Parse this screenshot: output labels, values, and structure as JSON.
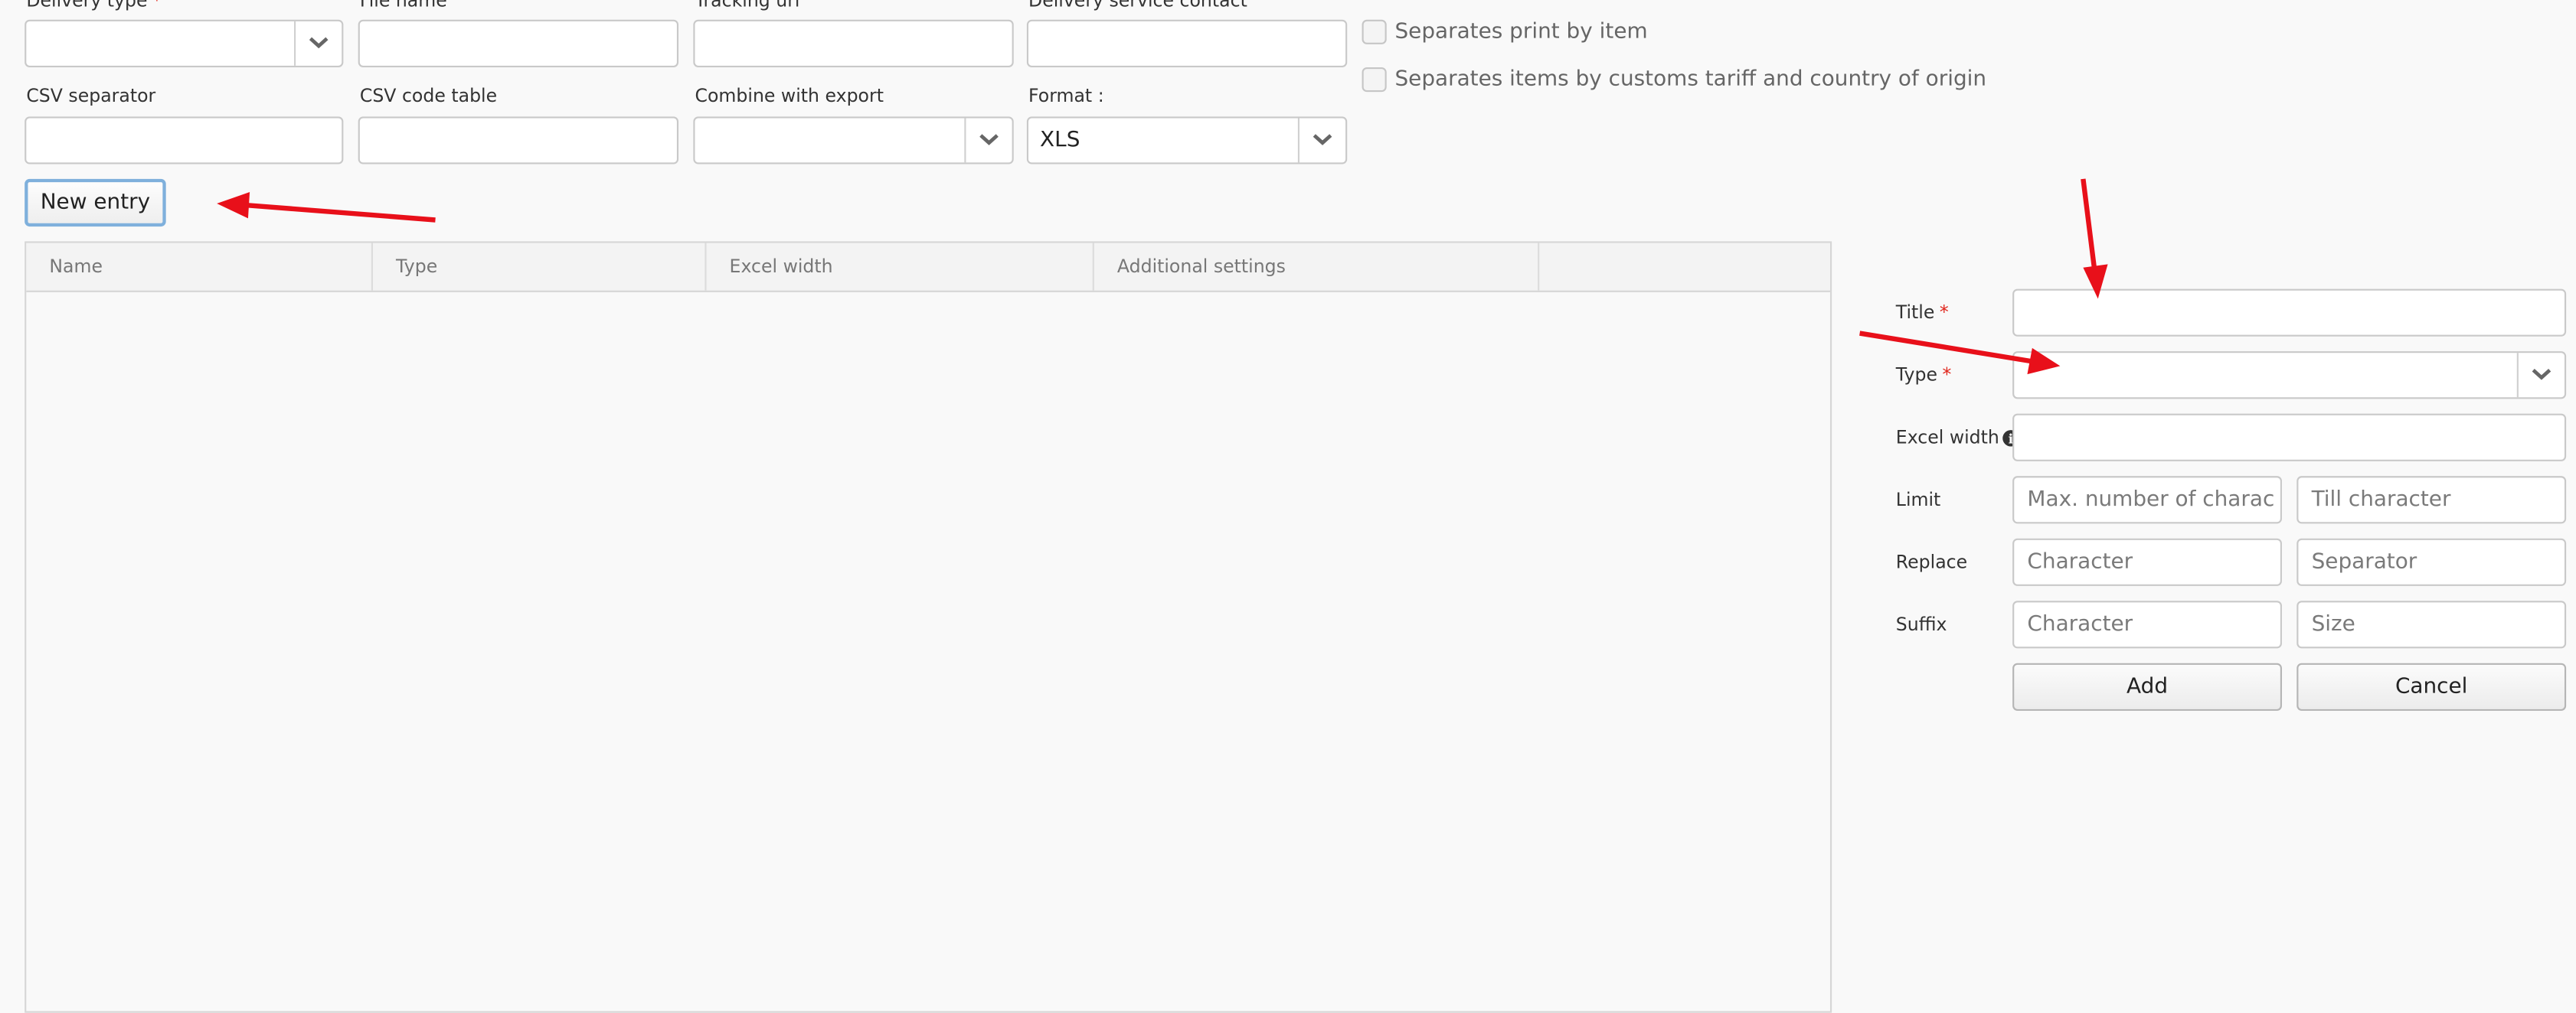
{
  "form": {
    "delivery_type_label": "Delivery type",
    "file_name_label": "File name",
    "tracking_url_label": "Tracking url",
    "delivery_service_contact_label": "Delivery service contact",
    "csv_separator_label": "CSV separator",
    "csv_code_table_label": "CSV code table",
    "combine_with_export_label": "Combine with export",
    "format_label": "Format :",
    "format_value": "XLS",
    "required_marker": "*",
    "separates_print_label": "Separates print by item",
    "separates_customs_label": "Separates items by customs tariff and country of origin"
  },
  "actions": {
    "new_entry": "New entry"
  },
  "grid": {
    "columns": [
      "Name",
      "Type",
      "Excel width",
      "Additional settings",
      ""
    ]
  },
  "entry_form": {
    "title_label": "Title",
    "type_label": "Type",
    "excel_width_label": "Excel width",
    "info_glyph": "i",
    "limit_label": "Limit",
    "limit_max_placeholder": "Max. number of characters",
    "limit_till_placeholder": "Till character",
    "replace_label": "Replace",
    "replace_char_placeholder": "Character",
    "replace_sep_placeholder": "Separator",
    "suffix_label": "Suffix",
    "suffix_char_placeholder": "Character",
    "suffix_size_placeholder": "Size",
    "add_button": "Add",
    "cancel_button": "Cancel"
  },
  "icons": {
    "select_arrow": "chevron-down-icon",
    "info": "info-icon"
  },
  "colors": {
    "required": "#e0261c",
    "annotation_arrow": "#e8101a",
    "focus_border": "#7fb0dc"
  }
}
